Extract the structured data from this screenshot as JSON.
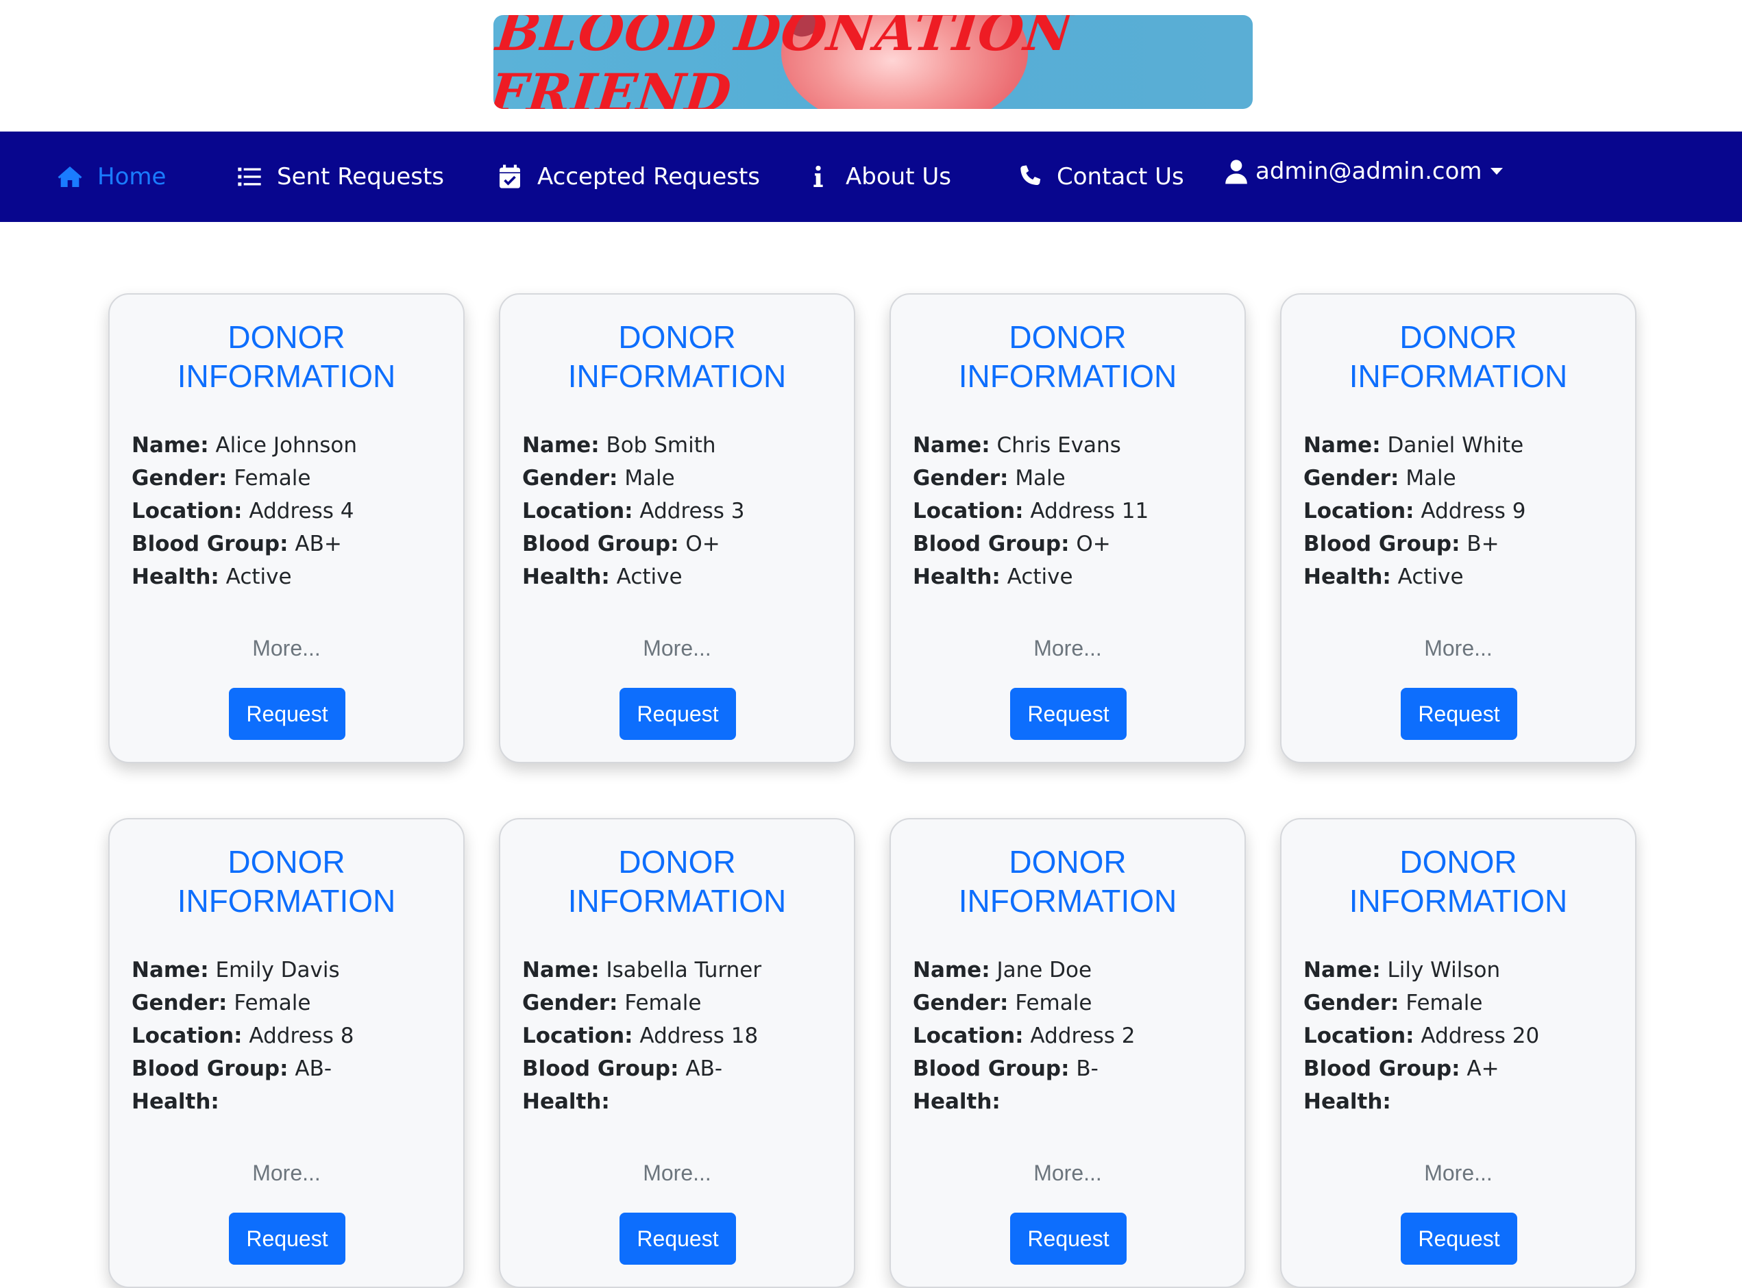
{
  "banner": {
    "title": "BLOOD DONATION FRIEND"
  },
  "nav": {
    "home": "Home",
    "sent_requests": "Sent Requests",
    "accepted_requests": "Accepted Requests",
    "about_us": "About Us",
    "contact_us": "Contact Us",
    "user": "admin@admin.com"
  },
  "labels": {
    "name": "Name:",
    "gender": "Gender:",
    "location": "Location:",
    "blood_group": "Blood Group:",
    "health": "Health:"
  },
  "card_title": [
    "DONOR",
    "INFORMATION"
  ],
  "more_label": "More...",
  "request_label": "Request",
  "colors": {
    "navbar": "#08068e",
    "active_link": "#1a7cff",
    "primary": "#0d6efd",
    "banner_text": "#ee1c24"
  },
  "donors": [
    {
      "name": "Alice Johnson",
      "gender": "Female",
      "location": "Address 4",
      "blood_group": "AB+",
      "health": "Active"
    },
    {
      "name": "Bob Smith",
      "gender": "Male",
      "location": "Address 3",
      "blood_group": "O+",
      "health": "Active"
    },
    {
      "name": "Chris Evans",
      "gender": "Male",
      "location": "Address 11",
      "blood_group": "O+",
      "health": "Active"
    },
    {
      "name": "Daniel White",
      "gender": "Male",
      "location": "Address 9",
      "blood_group": "B+",
      "health": "Active"
    },
    {
      "name": "Emily Davis",
      "gender": "Female",
      "location": "Address 8",
      "blood_group": "AB-",
      "health": ""
    },
    {
      "name": "Isabella Turner",
      "gender": "Female",
      "location": "Address 18",
      "blood_group": "AB-",
      "health": ""
    },
    {
      "name": "Jane Doe",
      "gender": "Female",
      "location": "Address 2",
      "blood_group": "B-",
      "health": ""
    },
    {
      "name": "Lily Wilson",
      "gender": "Female",
      "location": "Address 20",
      "blood_group": "A+",
      "health": ""
    }
  ]
}
